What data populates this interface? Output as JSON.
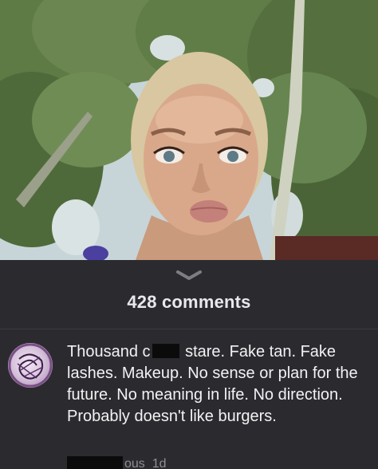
{
  "comments": {
    "count_label": "428 comments"
  },
  "comment": {
    "text_part1": "Thousand c",
    "text_part2": " stare. Fake tan. Fake lashes. Makeup. No sense or plan for the future. No meaning in life. No direction. Probably doesn't like burgers.",
    "author_suffix": "ous",
    "age": "1d"
  },
  "icons": {
    "expand": "chevron-down-icon",
    "avatar": "avatar"
  },
  "colors": {
    "panel_bg": "#2b2b2f",
    "text_primary": "#f2f2f4",
    "text_secondary": "#8e8e93",
    "redaction": "#0b0b0c"
  }
}
